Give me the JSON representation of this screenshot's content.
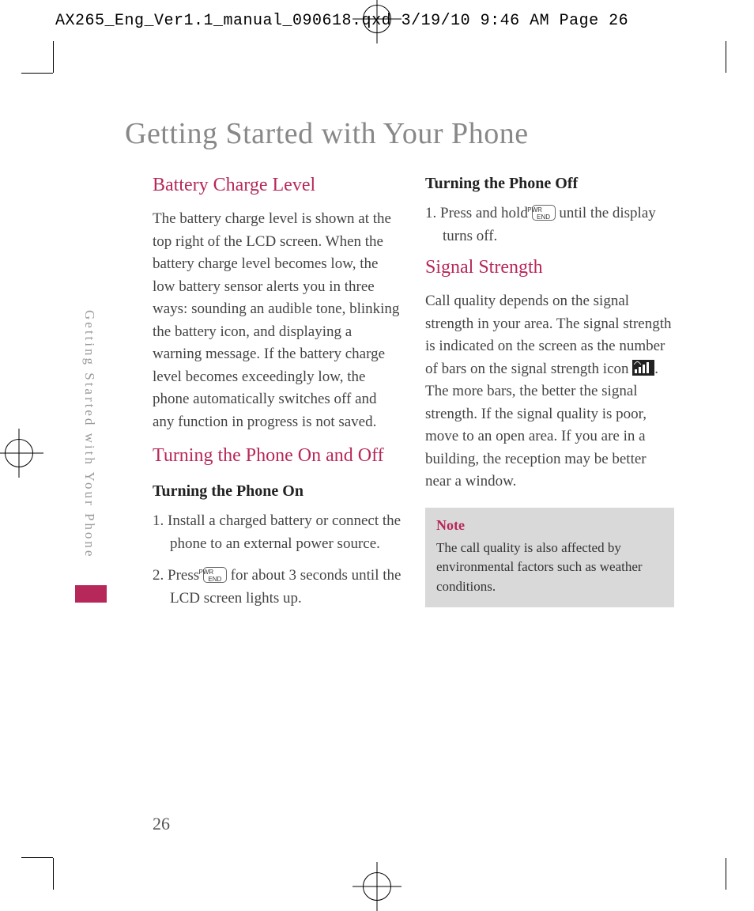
{
  "print_header": "AX265_Eng_Ver1.1_manual_090618.qxd  3/19/10  9:46 AM  Page 26",
  "main_title": "Getting Started with Your Phone",
  "side_text": "Getting Started with Your Phone",
  "page_number": "26",
  "left_col": {
    "h_battery": "Battery Charge Level",
    "p_battery": "The battery charge level is shown at the top right of the LCD screen. When the battery charge level becomes low, the low battery sensor alerts you in three ways: sounding an audible tone, blinking the battery icon, and displaying a warning message. If the battery charge level becomes exceedingly low, the phone automatically switches off and any function in progress is not saved.",
    "h_onoff": "Turning the Phone On and Off",
    "sub_on": "Turning the Phone On",
    "step1": "1. Install a charged battery or connect the phone to an external power source.",
    "step2a": "2. Press ",
    "step2b": " for about 3 seconds until the LCD screen lights up."
  },
  "right_col": {
    "sub_off": "Turning the Phone Off",
    "off1a": "1. Press and hold ",
    "off1b": " until the display turns off.",
    "h_signal": "Signal Strength",
    "p_signal_a": "Call quality depends on the signal strength in your area. The signal strength is indicated on the screen as the number of bars on the signal strength icon ",
    "p_signal_b": ". The more bars, the better the signal strength. If the signal quality is poor, move to an open area. If you are in a building, the reception may be better near a window.",
    "note_label": "Note",
    "note_text": "The call quality is also affected by environmental factors such as weather conditions."
  }
}
